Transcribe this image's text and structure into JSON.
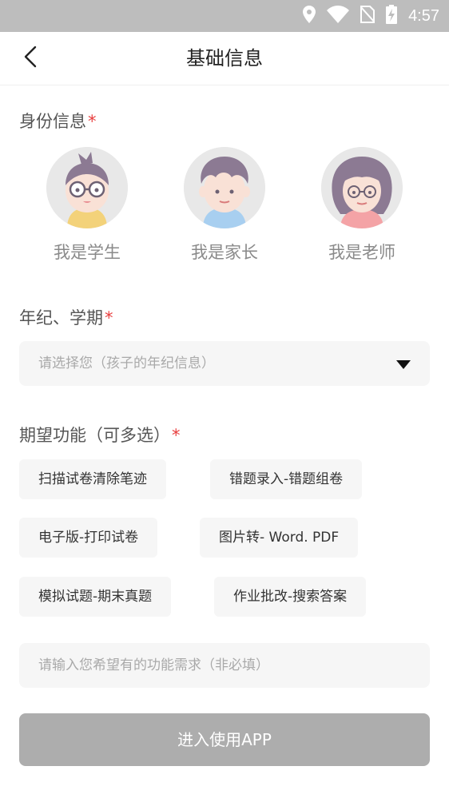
{
  "status_bar": {
    "time": "4:57",
    "icons": [
      "location-icon",
      "wifi-icon",
      "no-sim-icon",
      "battery-charging-icon"
    ],
    "background": "#bdbdbd"
  },
  "nav": {
    "title": "基础信息",
    "back_icon": "chevron-left-icon"
  },
  "identity": {
    "label": "身份信息",
    "required_mark": "*",
    "roles": [
      {
        "label": "我是学生",
        "icon": "student-avatar-icon"
      },
      {
        "label": "我是家长",
        "icon": "parent-avatar-icon"
      },
      {
        "label": "我是老师",
        "icon": "teacher-avatar-icon"
      }
    ]
  },
  "grade": {
    "label": "年纪、学期",
    "required_mark": "*",
    "placeholder": "请选择您（孩子的年纪信息）",
    "arrow_icon": "triangle-down-icon"
  },
  "features": {
    "label": "期望功能（可多选）",
    "required_mark": "*",
    "options": [
      "扫描试卷清除笔迹",
      "错题录入-错题组卷",
      "电子版-打印试卷",
      "图片转- Word. PDF",
      "模拟试题-期末真题",
      "作业批改-搜索答案"
    ],
    "input_placeholder": "请输入您希望有的功能需求（非必填）"
  },
  "submit": {
    "label": "进入使用APP",
    "background": "#adadad"
  },
  "colors": {
    "required": "#e83d3d",
    "chip_background": "#f6f6f6"
  }
}
